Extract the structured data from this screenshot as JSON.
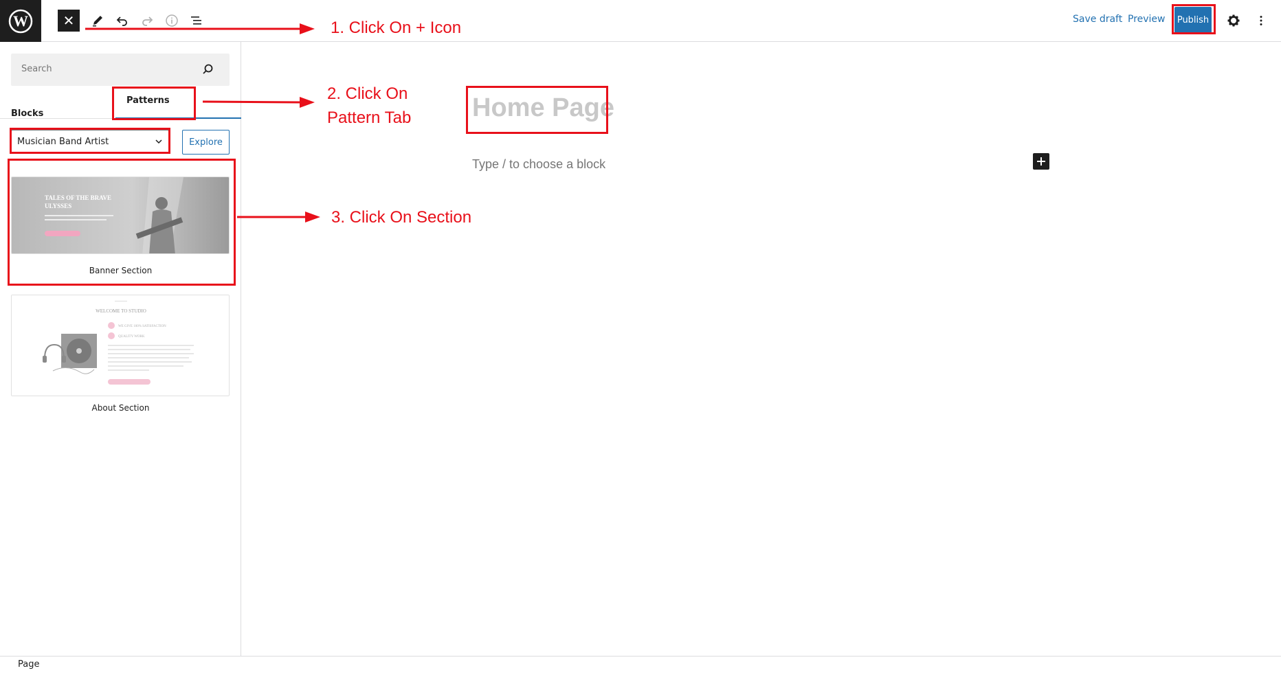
{
  "topbar": {
    "close_icon": "close-icon",
    "tools": [
      "pencil-icon",
      "undo-icon",
      "redo-icon",
      "info-icon",
      "list-view-icon"
    ],
    "save_draft": "Save draft",
    "preview": "Preview",
    "publish": "Publish",
    "settings_icon": "gear-icon",
    "more_icon": "more-vertical-icon"
  },
  "inserter": {
    "search_placeholder": "Search",
    "tabs": {
      "blocks": "Blocks",
      "patterns": "Patterns"
    },
    "category_selected": "Musician Band Artist",
    "explore": "Explore",
    "patterns": [
      {
        "label": "Banner Section",
        "preview_heading_line1": "TALES OF THE BRAVE",
        "preview_heading_line2": "ULYSSES"
      },
      {
        "label": "About Section",
        "preview_heading": "WELCOME TO STUDIO",
        "preview_item1": "WE GIVE 100% SATISFACTION",
        "preview_item2": "QUALITY WORK"
      }
    ]
  },
  "canvas": {
    "title": "Home Page",
    "appender_placeholder": "Type / to choose a block"
  },
  "footer": {
    "breadcrumb": "Page"
  },
  "annotations": {
    "step1": "1. Click On + Icon",
    "step2_line1": "2. Click On",
    "step2_line2": "Pattern Tab",
    "step3": "3. Click On Section",
    "color": "#e8101a"
  },
  "colors": {
    "accent": "#2271b1",
    "dark": "#1e1e1e"
  }
}
